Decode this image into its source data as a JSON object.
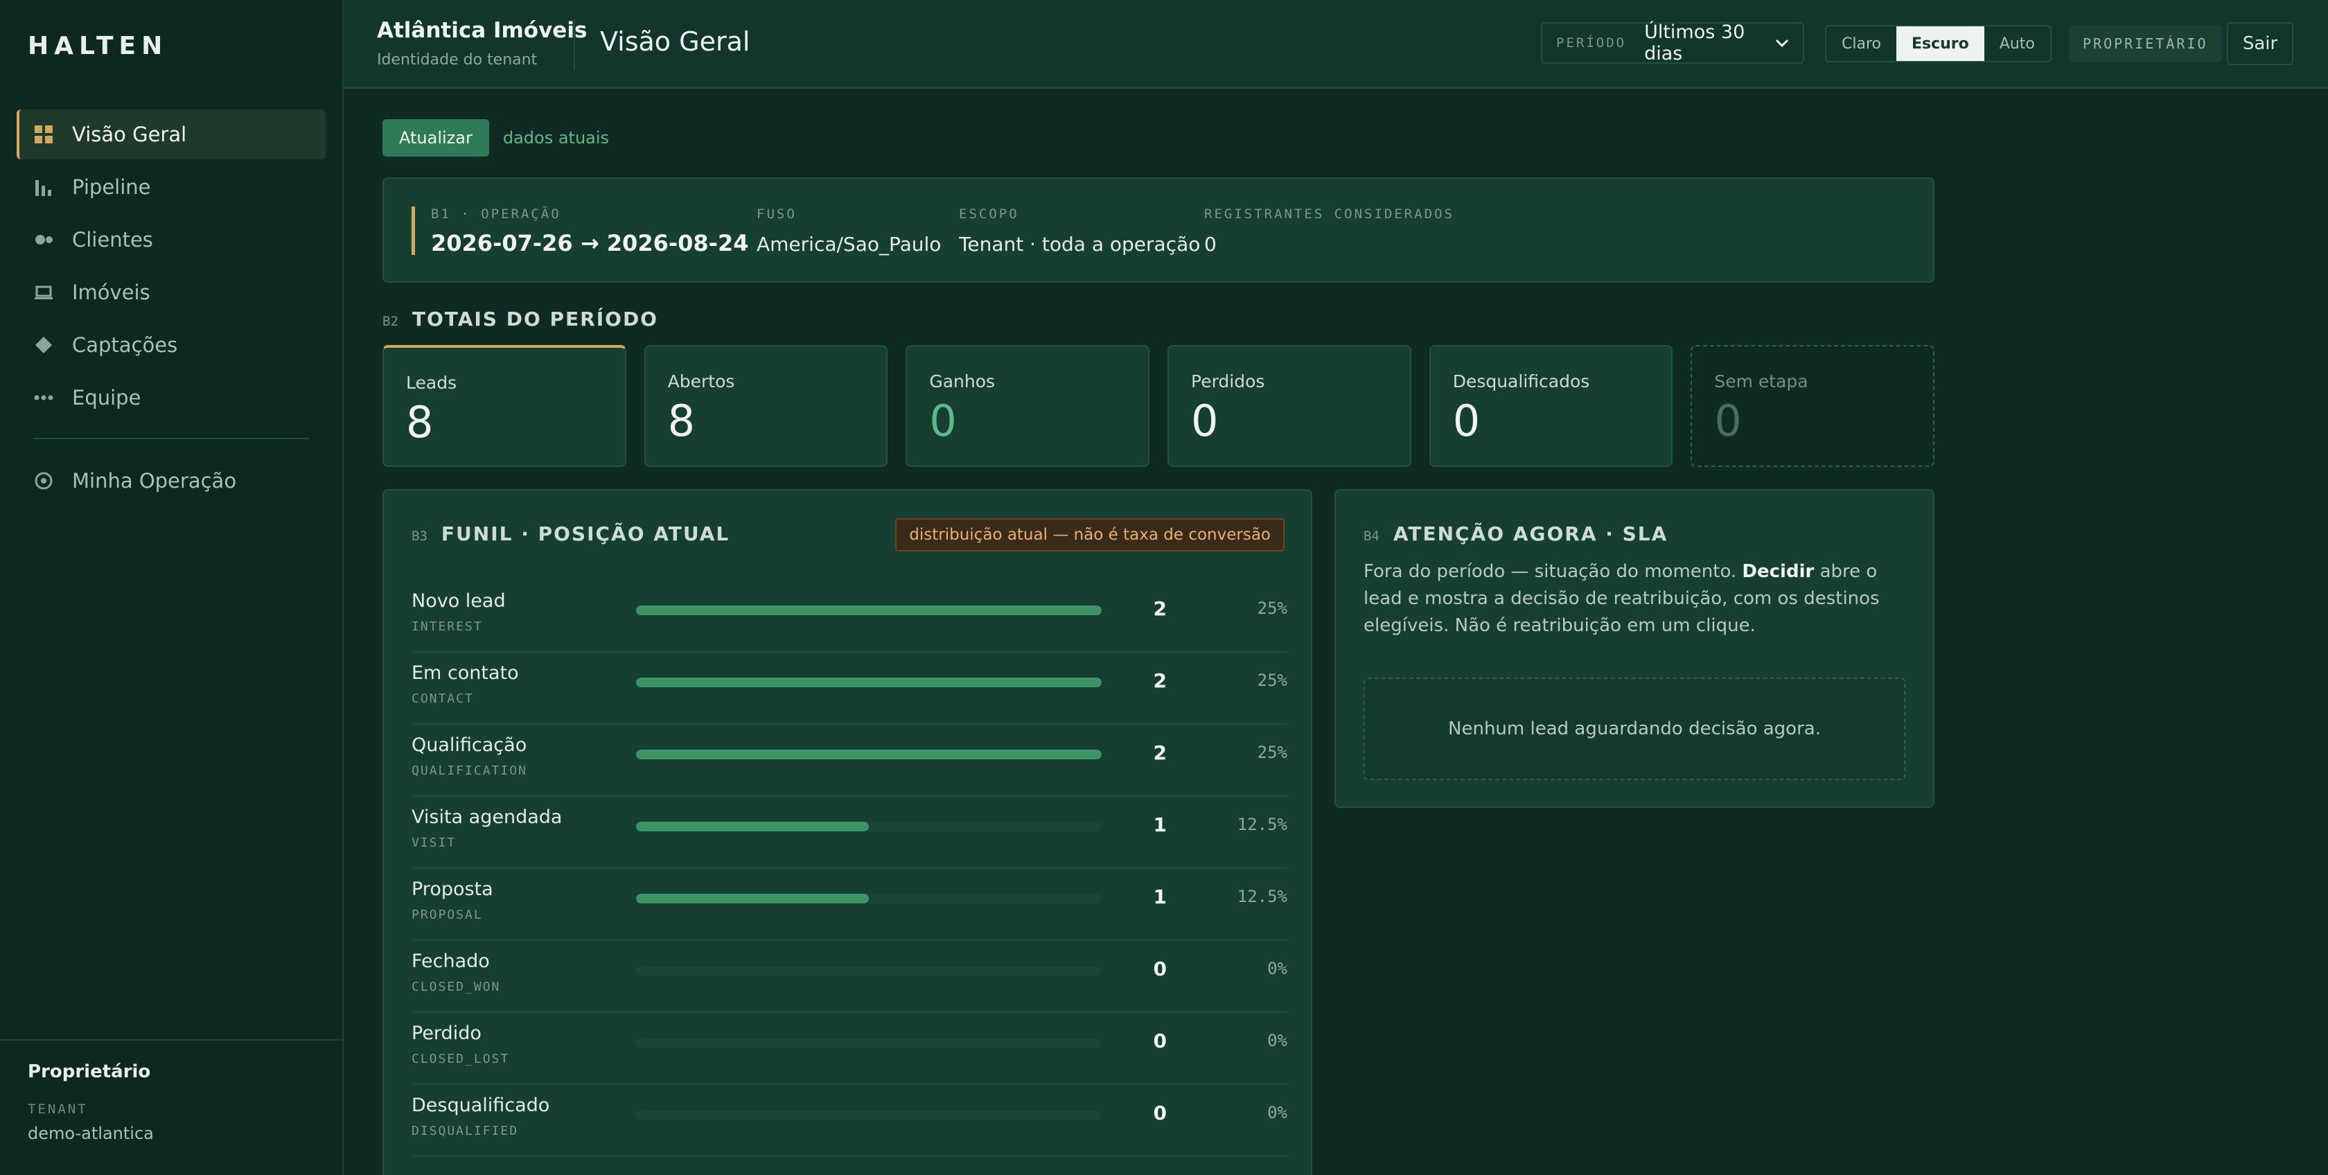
{
  "sidebar": {
    "brand": "HALTEN",
    "items": [
      {
        "label": "Visão Geral",
        "icon": "grid-icon",
        "active": true
      },
      {
        "label": "Pipeline",
        "icon": "bar-chart-icon"
      },
      {
        "label": "Clientes",
        "icon": "people-icon"
      },
      {
        "label": "Imóveis",
        "icon": "laptop-icon"
      },
      {
        "label": "Captações",
        "icon": "diamond-icon"
      },
      {
        "label": "Equipe",
        "icon": "dots-icon"
      }
    ],
    "secondary": {
      "label": "Minha Operação",
      "icon": "target-icon"
    },
    "footer": {
      "role": "Proprietário",
      "tenant_label": "TENANT",
      "tenant": "demo-atlantica"
    }
  },
  "topbar": {
    "org_name": "Atlântica Imóveis",
    "org_sub": "Identidade do tenant",
    "page_title": "Visão Geral",
    "period_label": "PERÍODO",
    "period_value": "Últimos 30 dias",
    "themes": [
      "Claro",
      "Escuro",
      "Auto"
    ],
    "active_theme": "Escuro",
    "role_chip": "PROPRIETÁRIO",
    "logout": "Sair"
  },
  "main": {
    "refresh": "Atualizar",
    "refresh_note": "dados atuais",
    "b1": {
      "code": "B1 · OPERAÇÃO",
      "range": "2026-07-26 → 2026-08-24",
      "fuso_label": "FUSO",
      "fuso": "America/Sao_Paulo",
      "escopo_label": "ESCOPO",
      "escopo": "Tenant · toda a operação",
      "reg_label": "REGISTRANTES CONSIDERADOS",
      "reg": "0"
    },
    "b2": {
      "code": "B2",
      "title": "TOTAIS DO PERÍODO",
      "cards": [
        {
          "label": "Leads",
          "value": "8"
        },
        {
          "label": "Abertos",
          "value": "8"
        },
        {
          "label": "Ganhos",
          "value": "0"
        },
        {
          "label": "Perdidos",
          "value": "0"
        },
        {
          "label": "Desqualificados",
          "value": "0"
        },
        {
          "label": "Sem etapa",
          "value": "0"
        }
      ]
    },
    "b3": {
      "code": "B3",
      "title": "FUNIL · POSIÇÃO ATUAL",
      "badge": "distribuição atual — não é taxa de conversão",
      "stages": [
        {
          "name": "Novo lead",
          "code": "INTEREST",
          "count": "2",
          "pct": "25%",
          "share": 0.25
        },
        {
          "name": "Em contato",
          "code": "CONTACT",
          "count": "2",
          "pct": "25%",
          "share": 0.25
        },
        {
          "name": "Qualificação",
          "code": "QUALIFICATION",
          "count": "2",
          "pct": "25%",
          "share": 0.25
        },
        {
          "name": "Visita agendada",
          "code": "VISIT",
          "count": "1",
          "pct": "12.5%",
          "share": 0.125
        },
        {
          "name": "Proposta",
          "code": "PROPOSAL",
          "count": "1",
          "pct": "12.5%",
          "share": 0.125
        },
        {
          "name": "Fechado",
          "code": "CLOSED_WON",
          "count": "0",
          "pct": "0%",
          "share": 0
        },
        {
          "name": "Perdido",
          "code": "CLOSED_LOST",
          "count": "0",
          "pct": "0%",
          "share": 0
        },
        {
          "name": "Desqualificado",
          "code": "DISQUALIFIED",
          "count": "0",
          "pct": "0%",
          "share": 0
        }
      ]
    },
    "b4": {
      "code": "B4",
      "title": "ATENÇÃO AGORA · SLA",
      "text_before": "Fora do período — situação do momento. ",
      "text_bold": "Decidir",
      "text_after": " abre o lead e mostra a decisão de reatribuição, com os destinos elegíveis. Não é reatribuição em um clique.",
      "empty": "Nenhum lead aguardando decisão agora."
    }
  },
  "colors": {
    "accent_gold": "#d2a95e",
    "accent_green": "#3f9466",
    "background": "#0f2a22"
  }
}
